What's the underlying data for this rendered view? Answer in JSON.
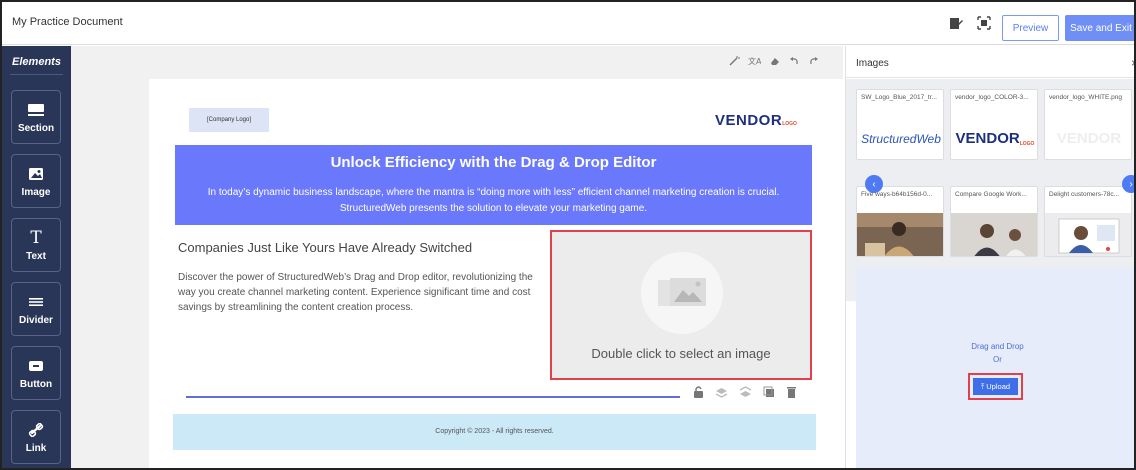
{
  "app": {
    "document_title": "My Practice Document",
    "preview_label": "Preview",
    "save_exit_label": "Save and Exit"
  },
  "sidebar": {
    "title": "Elements",
    "items": [
      {
        "label": "Section",
        "icon": "section-icon"
      },
      {
        "label": "Image",
        "icon": "image-icon"
      },
      {
        "label": "Text",
        "icon": "text-icon"
      },
      {
        "label": "Divider",
        "icon": "divider-icon"
      },
      {
        "label": "Button",
        "icon": "button-icon"
      },
      {
        "label": "Link",
        "icon": "link-icon"
      }
    ]
  },
  "canvas": {
    "company_logo": "[Company Logo]",
    "vendor_logo": "VENDOR",
    "vendor_logo_sub": "LOGO",
    "banner_heading": "Unlock Efficiency with the Drag & Drop Editor",
    "banner_text": "In today’s dynamic business landscape, where the mantra is “doing more with less” efficient channel marketing creation is crucial. StructuredWeb presents the solution to elevate your marketing game.",
    "section_heading": "Companies Just Like Yours Have Already Switched",
    "section_body": "Discover the power of StructuredWeb’s Drag and Drop editor, revolutionizing the way you create channel marketing content. Experience significant time and cost savings by streamlining the content creation process.",
    "image_placeholder_text": "Double click to select an image",
    "footer_text": "Copyright © 2023 - All rights reserved."
  },
  "images_panel": {
    "title": "Images",
    "thumbnails": [
      {
        "caption": "SW_Logo_Blue_2017_tr...",
        "art_text": "StructuredWeb"
      },
      {
        "caption": "vendor_logo_COLOR-3...",
        "art_text": "VENDOR",
        "art_sub": "LOGO"
      },
      {
        "caption": "vendor_logo_WHITE.png",
        "art_text": "VENDOR"
      },
      {
        "caption": "Five ways-b64b156d-0..."
      },
      {
        "caption": "Compare Google Work..."
      },
      {
        "caption": "Delight customers-78c..."
      }
    ],
    "drag_drop_text": "Drag and Drop",
    "or_text": "Or",
    "upload_label": "Upload"
  },
  "colors": {
    "sidebar_bg": "#2a3658",
    "accent": "#6a78fb",
    "highlight_border": "#e0414a",
    "footer_bg": "#cbe9f7"
  }
}
